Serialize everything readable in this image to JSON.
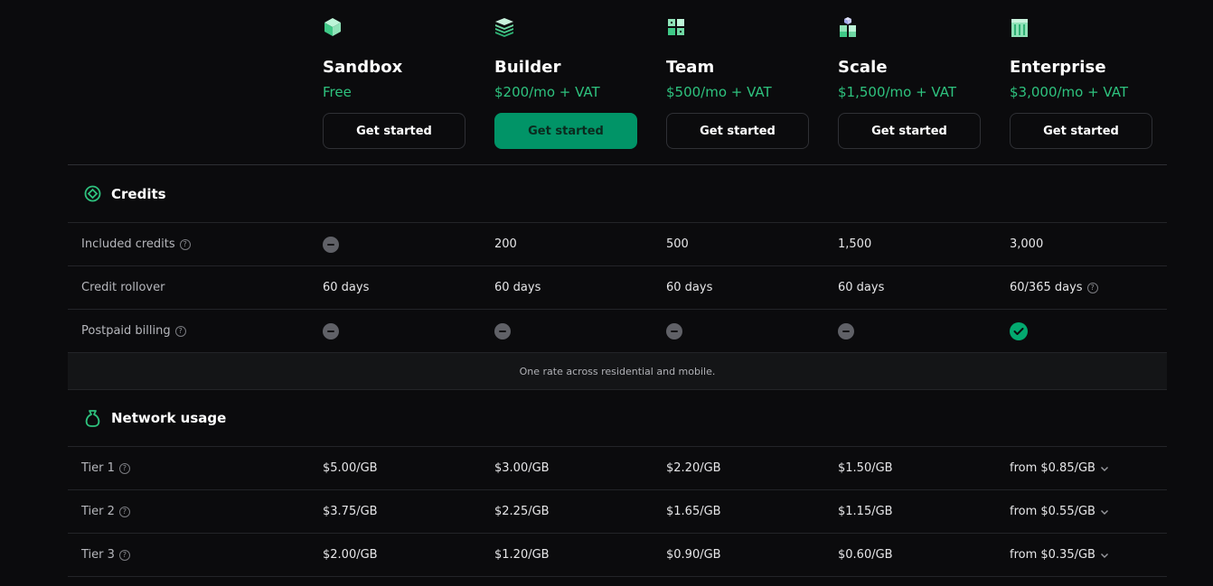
{
  "plans": [
    {
      "name": "Sandbox",
      "price": "Free",
      "cta": "Get started",
      "icon": "cube-icon"
    },
    {
      "name": "Builder",
      "price": "$200/mo + VAT",
      "cta": "Get started",
      "icon": "stacked-layers-icon"
    },
    {
      "name": "Team",
      "price": "$500/mo + VAT",
      "cta": "Get started",
      "icon": "cube-cluster-icon"
    },
    {
      "name": "Scale",
      "price": "$1,500/mo + VAT",
      "cta": "Get started",
      "icon": "cube-pyramid-icon"
    },
    {
      "name": "Enterprise",
      "price": "$3,000/mo + VAT",
      "cta": "Get started",
      "icon": "building-icon"
    }
  ],
  "credits": {
    "title": "Credits",
    "rows": [
      {
        "label": "Included credits",
        "help": "?",
        "values": [
          "—",
          "200",
          "500",
          "1,500",
          "3,000"
        ]
      },
      {
        "label": "Credit rollover",
        "values": [
          "60 days",
          "60 days",
          "60 days",
          "60 days",
          "60/365 days"
        ],
        "help_last": "?"
      },
      {
        "label": "Postpaid billing",
        "help": "?",
        "values": [
          "not-included",
          "not-included",
          "not-included",
          "not-included",
          "included"
        ]
      }
    ],
    "note": "One rate across residential and mobile."
  },
  "network": {
    "title": "Network usage",
    "rows": [
      {
        "label": "Tier 1",
        "help": "?",
        "values": [
          "$5.00/GB",
          "$3.00/GB",
          "$2.20/GB",
          "$1.50/GB",
          "from $0.85/GB"
        ]
      },
      {
        "label": "Tier 2",
        "help": "?",
        "values": [
          "$3.75/GB",
          "$2.25/GB",
          "$1.65/GB",
          "$1.15/GB",
          "from $0.55/GB"
        ]
      },
      {
        "label": "Tier 3",
        "help": "?",
        "values": [
          "$2.00/GB",
          "$1.20/GB",
          "$0.90/GB",
          "$0.60/GB",
          "from $0.35/GB"
        ]
      }
    ]
  },
  "colors": {
    "accent": "#2ec27e",
    "primary_button": "#019467",
    "background": "#0b0b0d",
    "check": "#03a96f",
    "minus": "#606167"
  }
}
